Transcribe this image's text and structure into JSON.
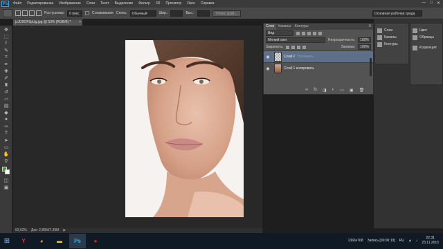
{
  "menubar": {
    "logo": "Ps",
    "items": [
      "Файл",
      "Редактирование",
      "Изображение",
      "Слои",
      "Текст",
      "Выделение",
      "Фильтр",
      "3D",
      "Просмотр",
      "Окно",
      "Справка"
    ],
    "min": "—",
    "max": "□",
    "close": "✕"
  },
  "options": {
    "feather_label": "Растушевка:",
    "feather_value": "0 пикс.",
    "antialias_label": "Сглаживание",
    "styles_label": "Стиль:",
    "style_value": "Обычный",
    "width_label": "Шир.:",
    "height_label": "Выс.:",
    "refine_btn": "Уточн. край...",
    "workspace": "Основная рабочая среда"
  },
  "document": {
    "tab": "jzJD9OF5pUg.jpg @ 53% (RGB/8) *",
    "close": "×"
  },
  "status": {
    "zoom": "53,62%",
    "doc": "Док: 2,88M/7,39M"
  },
  "layers_panel": {
    "tabs": [
      "Слои",
      "Каналы",
      "Контуры"
    ],
    "kind": "Вид",
    "blend": "Мягкий свет",
    "opacity_label": "Непрозрачность:",
    "opacity_value": "100%",
    "lock_label": "Закрепить:",
    "fill_label": "Заливка:",
    "fill_value": "100%",
    "layers": [
      {
        "name": "Слой 2",
        "extra": "Наложить",
        "selected": true
      },
      {
        "name": "Слой 1 копировать",
        "extra": "",
        "selected": false
      }
    ],
    "footer_icons": [
      "∞",
      "fx",
      "◨",
      "◐",
      "▭",
      "▣",
      "🗑"
    ]
  },
  "dock_left": {
    "items": [
      "Слои",
      "Каналы",
      "Контуры"
    ]
  },
  "dock_right": {
    "items": [
      "Цвет",
      "Образцы",
      "Коррекция"
    ]
  },
  "taskbar": {
    "lang": "RU",
    "time": "22:31",
    "date": "23.11.2015",
    "resolution": "1366x768",
    "record": "Запись [00:06:19]"
  }
}
